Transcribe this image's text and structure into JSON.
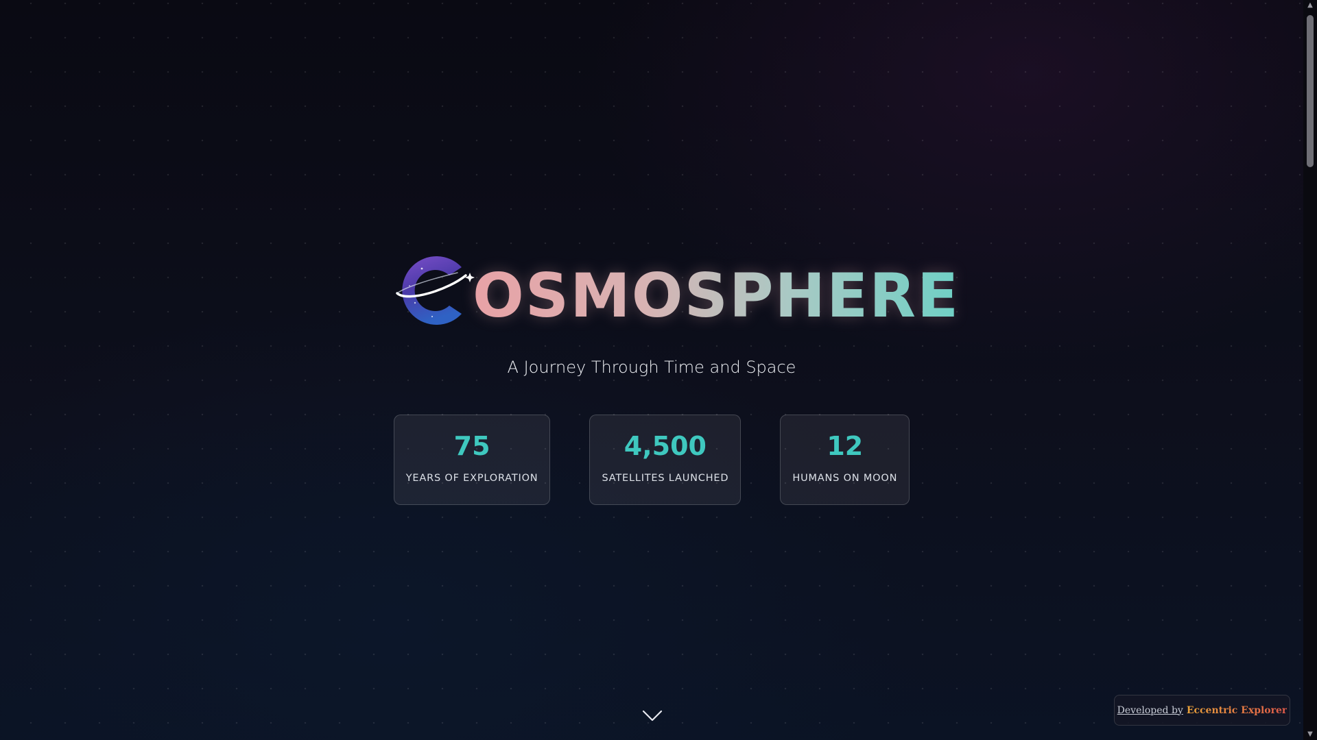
{
  "hero": {
    "title": "OSMOSPHERE",
    "logo_icon": "planet-ring-c-icon",
    "subtitle": "A Journey Through Time and Space"
  },
  "stats": [
    {
      "value": "75",
      "label": "YEARS OF EXPLORATION"
    },
    {
      "value": "4,500",
      "label": "SATELLITES LAUNCHED"
    },
    {
      "value": "12",
      "label": "HUMANS ON MOON"
    }
  ],
  "scroll_hint": {
    "icon": "chevron-down-icon"
  },
  "credit": {
    "prefix": "Developed by",
    "name": "Eccentric Explorer"
  },
  "colors": {
    "accent_teal": "#3fc8bf",
    "title_gradient_start": "#e8a2a6",
    "title_gradient_end": "#6fd0c5",
    "background": "#0d0f1c"
  }
}
